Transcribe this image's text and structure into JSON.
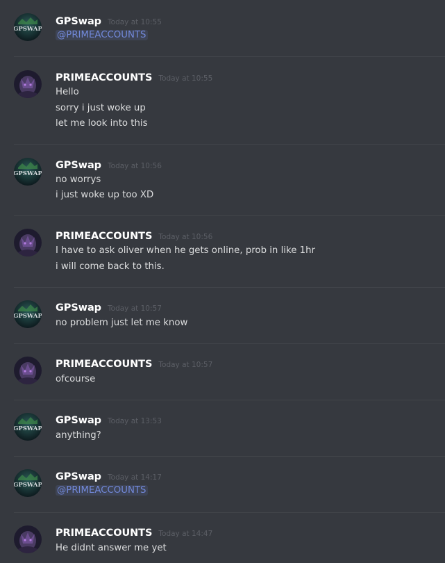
{
  "colors": {
    "background": "#36393f",
    "username": "#ffffff",
    "timestamp": "#5c5f66",
    "text": "#dcddde",
    "mention": "#7289da"
  },
  "messages": [
    {
      "author": "GPSwap",
      "avatar": "gpswap-avatar",
      "time": "Today at 10:55",
      "lines": [
        "@PRIMEACCOUNTS"
      ],
      "mention": true
    },
    {
      "author": "PRIMEACCOUNTS",
      "avatar": "primeaccounts-avatar",
      "time": "Today at 10:55",
      "lines": [
        "Hello",
        "sorry i just woke up",
        "let me look into this"
      ]
    },
    {
      "author": "GPSwap",
      "avatar": "gpswap-avatar",
      "time": "Today at 10:56",
      "lines": [
        "no worrys",
        "i just woke up too XD"
      ]
    },
    {
      "author": "PRIMEACCOUNTS",
      "avatar": "primeaccounts-avatar",
      "time": "Today at 10:56",
      "lines": [
        "I have to ask oliver when he gets online, prob in like 1hr",
        "i will come back to this."
      ]
    },
    {
      "author": "GPSwap",
      "avatar": "gpswap-avatar",
      "time": "Today at 10:57",
      "lines": [
        "no problem just let me know"
      ]
    },
    {
      "author": "PRIMEACCOUNTS",
      "avatar": "primeaccounts-avatar",
      "time": "Today at 10:57",
      "lines": [
        "ofcourse"
      ]
    },
    {
      "author": "GPSwap",
      "avatar": "gpswap-avatar",
      "time": "Today at 13:53",
      "lines": [
        "anything?"
      ]
    },
    {
      "author": "GPSwap",
      "avatar": "gpswap-avatar",
      "time": "Today at 14:17",
      "lines": [
        "@PRIMEACCOUNTS"
      ],
      "mention": true
    },
    {
      "author": "PRIMEACCOUNTS",
      "avatar": "primeaccounts-avatar",
      "time": "Today at 14:47",
      "lines": [
        "He didnt answer me yet"
      ]
    }
  ],
  "avatar_text": {
    "gpswap": "GPSWAP"
  }
}
